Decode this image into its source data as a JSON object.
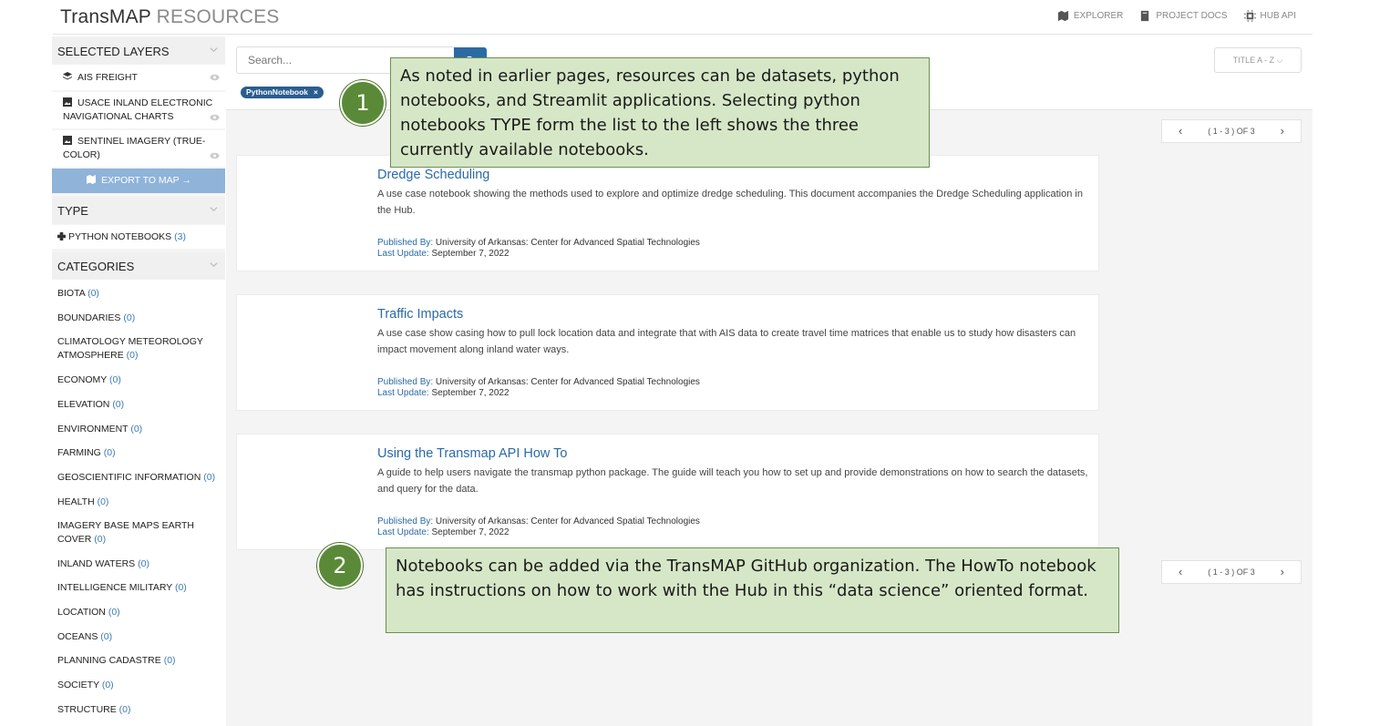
{
  "header": {
    "brand": "TransMAP",
    "subtitle": " RESOURCES",
    "nav": [
      {
        "label": "EXPLORER",
        "icon": "map-icon"
      },
      {
        "label": "PROJECT DOCS",
        "icon": "book-icon"
      },
      {
        "label": "HUB API",
        "icon": "chip-icon"
      }
    ]
  },
  "sidebar": {
    "selected_layers": {
      "title": "SELECTED LAYERS",
      "items": [
        "AIS FREIGHT",
        "USACE INLAND ELECTRONIC NAVIGATIONAL CHARTS",
        "SENTINEL IMAGERY (TRUE-COLOR)"
      ],
      "export_label": "EXPORT TO MAP →"
    },
    "type": {
      "title": "TYPE",
      "item_label": "PYTHON NOTEBOOKS",
      "item_count": "(3)"
    },
    "categories": {
      "title": "CATEGORIES",
      "items": [
        {
          "label": "BIOTA",
          "count": "(0)"
        },
        {
          "label": "BOUNDARIES",
          "count": "(0)"
        },
        {
          "label": "CLIMATOLOGY METEOROLOGY ATMOSPHERE",
          "count": "(0)"
        },
        {
          "label": "ECONOMY",
          "count": "(0)"
        },
        {
          "label": "ELEVATION",
          "count": "(0)"
        },
        {
          "label": "ENVIRONMENT",
          "count": "(0)"
        },
        {
          "label": "FARMING",
          "count": "(0)"
        },
        {
          "label": "GEOSCIENTIFIC INFORMATION",
          "count": "(0)"
        },
        {
          "label": "HEALTH",
          "count": "(0)"
        },
        {
          "label": "IMAGERY BASE MAPS EARTH COVER",
          "count": "(0)"
        },
        {
          "label": "INLAND WATERS",
          "count": "(0)"
        },
        {
          "label": "INTELLIGENCE MILITARY",
          "count": "(0)"
        },
        {
          "label": "LOCATION",
          "count": "(0)"
        },
        {
          "label": "OCEANS",
          "count": "(0)"
        },
        {
          "label": "PLANNING CADASTRE",
          "count": "(0)"
        },
        {
          "label": "SOCIETY",
          "count": "(0)"
        },
        {
          "label": "STRUCTURE",
          "count": "(0)"
        }
      ]
    }
  },
  "search": {
    "placeholder": "Search..."
  },
  "filter_chip": {
    "label": "PythonNotebook",
    "remove": "×"
  },
  "sort": {
    "label": "TITLE A - Z ⌵"
  },
  "pager": {
    "label": "( 1 - 3 ) OF 3",
    "prev": "‹",
    "next": "›"
  },
  "results": [
    {
      "title": "Dredge Scheduling",
      "description": "A use case notebook showing the methods used to explore and optimize dredge scheduling. This document accompanies the Dredge Scheduling application in the Hub.",
      "published_label": "Published By:",
      "publisher": " University of Arkansas: Center for Advanced Spatial Technologies",
      "updated_label": "Last Update:",
      "updated": " September 7, 2022"
    },
    {
      "title": "Traffic Impacts",
      "description": "A use case show casing how to pull lock location data and integrate that with AIS data to create travel time matrices that enable us to study how disasters can impact movement along inland water ways.",
      "published_label": "Published By:",
      "publisher": " University of Arkansas: Center for Advanced Spatial Technologies",
      "updated_label": "Last Update:",
      "updated": " September 7, 2022"
    },
    {
      "title": "Using the Transmap API How To",
      "description": "A guide to help users navigate the transmap python package. The guide will teach you how to set up and provide demonstrations on how to search the datasets, and query for the data.",
      "published_label": "Published By:",
      "publisher": " University of Arkansas: Center for Advanced Spatial Technologies",
      "updated_label": "Last Update:",
      "updated": " September 7, 2022"
    }
  ],
  "annotations": {
    "marker1": "1",
    "callout1": "As noted in earlier pages, resources can be datasets, python notebooks, and Streamlit applications. Selecting python notebooks TYPE form the list to the left shows the three currently available notebooks.",
    "marker2": "2",
    "callout2": "Notebooks can be added via the TransMAP GitHub organization. The HowTo notebook has instructions on how to work with the Hub in this “data science” oriented format."
  },
  "colors": {
    "accent": "#2a6aa6",
    "callout_bg": "#d6e7c7",
    "marker": "#5a8a37",
    "export_button": "#8fb3d9"
  }
}
